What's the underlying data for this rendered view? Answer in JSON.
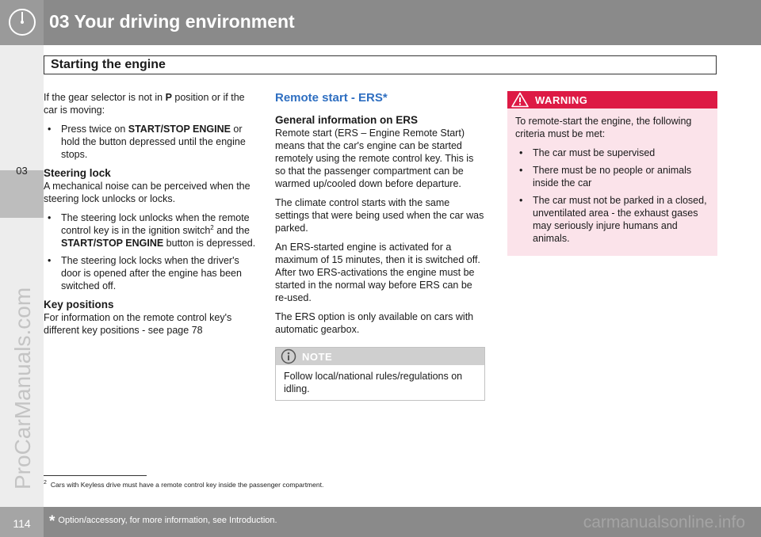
{
  "header": {
    "chapter_title": "03 Your driving environment",
    "section_title": "Starting the engine",
    "side_chapter_number": "03",
    "icon": "speedometer-gauge-icon"
  },
  "column1": {
    "intro_pre": "If the gear selector is not in ",
    "intro_bold": "P",
    "intro_post": " position or if the car is moving:",
    "bullet1_pre": "Press twice on ",
    "bullet1_bold": "START/STOP ENGINE",
    "bullet1_post": " or hold the button depressed until the engine stops.",
    "steering_heading": "Steering lock",
    "steering_text": "A mechanical noise can be perceived when the steering lock unlocks or locks.",
    "steering_bullet1_a": "The steering lock unlocks when the remote control key is in the ignition switch",
    "steering_bullet1_sup": "2",
    "steering_bullet1_b": " and the ",
    "steering_bullet1_bold": "START/STOP ENGINE",
    "steering_bullet1_c": " button is depressed.",
    "steering_bullet2": "The steering lock locks when the driver's door is opened after the engine has been switched off.",
    "key_heading": "Key positions",
    "key_text": "For information on the remote control key's different key positions - see page 78"
  },
  "column2": {
    "title": "Remote start - ERS*",
    "general_heading": "General information on ERS",
    "general_text": "Remote start (ERS – Engine Remote Start) means that the car's engine can be started remotely using the remote control key. This is so that the passenger compartment can be warmed up/cooled down before departure.",
    "climate_text": "The climate control starts with the same settings that were being used when the car was parked.",
    "activation_text": "An ERS-started engine is activated for a maximum of 15 minutes, then it is switched off. After two ERS-activations the engine must be started in the normal way before ERS can be re-used.",
    "gearbox_text": "The ERS option is only available on cars with automatic gearbox.",
    "note_label": "NOTE",
    "note_text": "Follow local/national rules/regulations on idling.",
    "note_icon": "info-icon"
  },
  "column3": {
    "warning_label": "WARNING",
    "warning_icon": "warning-triangle-icon",
    "warning_intro": "To remote-start the engine, the following criteria must be met:",
    "warning_items": [
      "The car must be supervised",
      "There must be no people or animals inside the car",
      "The car must not be parked in a closed, unventilated area - the exhaust gases may seriously injure humans and animals."
    ]
  },
  "footnote": {
    "number": "2",
    "text": "Cars with Keyless drive must have a remote control key inside the passenger compartment."
  },
  "footer": {
    "page_number": "114",
    "star": "*",
    "note": "Option/accessory, for more information, see Introduction.",
    "watermark_bottom": "carmanualsonline.info",
    "watermark_side": "ProCarManuals.com"
  },
  "colors": {
    "header_gray": "#8a8a8a",
    "accent_blue": "#2f6fc1",
    "warning_red": "#dd1a45",
    "warning_bg": "#fbe3ea",
    "note_gray": "#cfcfcf"
  }
}
